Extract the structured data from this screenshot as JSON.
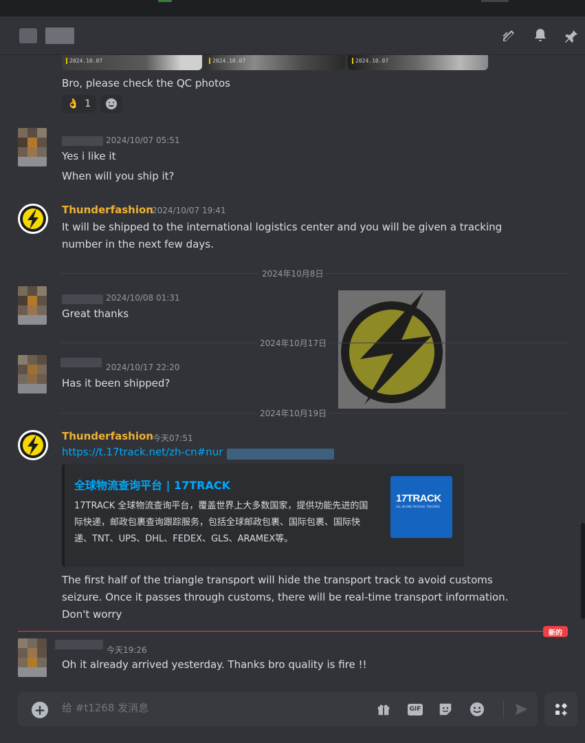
{
  "header": {
    "icons": [
      "threads-icon",
      "bell-icon",
      "pin-icon"
    ]
  },
  "thumbnails": [
    "2024.10.07",
    "2024.10.07",
    "2024.10.07"
  ],
  "msg_qc": {
    "text": "Bro, please check the QC photos",
    "reaction_count": "1"
  },
  "msg_yes": {
    "timestamp": "2024/10/07 05:51",
    "line1": "Yes i like it",
    "line2": "When will you ship it?"
  },
  "msg_ship": {
    "author": "Thunderfashion",
    "timestamp": "2024/10/07 19:41",
    "line1": "It will be shipped to the international logistics center and you will be given a tracking",
    "line2": "number in the next few days."
  },
  "div_oct8": "2024年10月8日",
  "msg_great": {
    "timestamp": "2024/10/08 01:31",
    "text": "Great thanks"
  },
  "div_oct17": "2024年10月17日",
  "msg_shipped": {
    "timestamp": "2024/10/17 22:20",
    "text": "Has it been shipped?"
  },
  "div_oct19": "2024年10月19日",
  "msg_track": {
    "author": "Thunderfashion",
    "timestamp": "今天07:51",
    "link": "https://t.17track.net/zh-cn#nur",
    "embed": {
      "title": "全球物流查询平台 | 17TRACK",
      "description": "17TRACK 全球物流查询平台，覆盖世界上大多数国家，提供功能先进的国际快递，邮政包裹查询跟踪服务，包括全球邮政包裹、国际包裹、国际快递、TNT、UPS、DHL、FEDEX、GLS、ARAMEX等。",
      "thumb_brand": "17TRACK",
      "thumb_tagline": "ALL-IN-ONE PACKAGE TRACKING"
    },
    "line1": "The first half of the triangle transport will hide the transport track to avoid customs",
    "line2": "seizure. Once it passes through customs, there will be real-time transport information.",
    "line3": "Don't worry"
  },
  "new_badge": "新的",
  "msg_arrived": {
    "timestamp": "今天19:26",
    "text": "Oh it already arrived yesterday. Thanks bro quality is fire !!"
  },
  "composer": {
    "placeholder": "给 #t1268 发消息",
    "gif_label": "GIF"
  },
  "colors": {
    "background": "#313338",
    "accent_link": "#00a8fc",
    "author_gold": "#f0b232",
    "new_red": "#f23f43"
  }
}
